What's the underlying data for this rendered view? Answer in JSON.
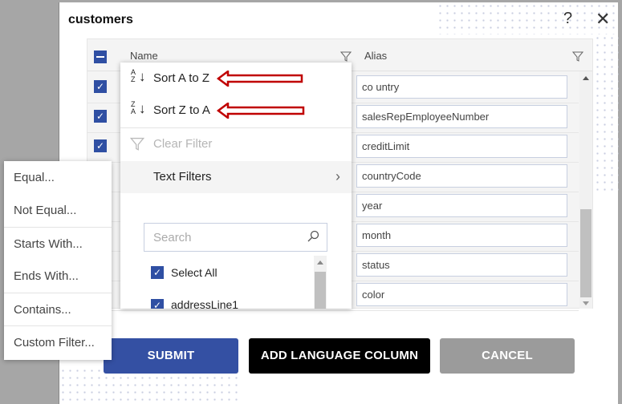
{
  "dialog": {
    "title": "customers",
    "help_icon": "?",
    "close_icon": "✕"
  },
  "grid": {
    "columns": [
      "Name",
      "Alias"
    ],
    "aliases": [
      "co untry",
      "salesRepEmployeeNumber",
      "creditLimit",
      "countryCode",
      "year",
      "month",
      "status",
      "color"
    ]
  },
  "filter_menu": {
    "sort_asc": "Sort A to Z",
    "sort_desc": "Sort Z to A",
    "clear_filter": "Clear Filter",
    "text_filters": "Text Filters",
    "search_placeholder": "Search",
    "items": [
      "Select All",
      "addressLine1"
    ]
  },
  "text_filter_submenu": [
    "Equal...",
    "Not Equal...",
    "Starts With...",
    "Ends With...",
    "Contains...",
    "Custom Filter..."
  ],
  "buttons": {
    "submit": "SUBMIT",
    "add_language": "ADD LANGUAGE COLUMN",
    "cancel": "CANCEL"
  },
  "colors": {
    "primary": "#3450a3",
    "black": "#000000",
    "cancel": "#9b9b9b",
    "annotation_arrow": "#c00000"
  }
}
